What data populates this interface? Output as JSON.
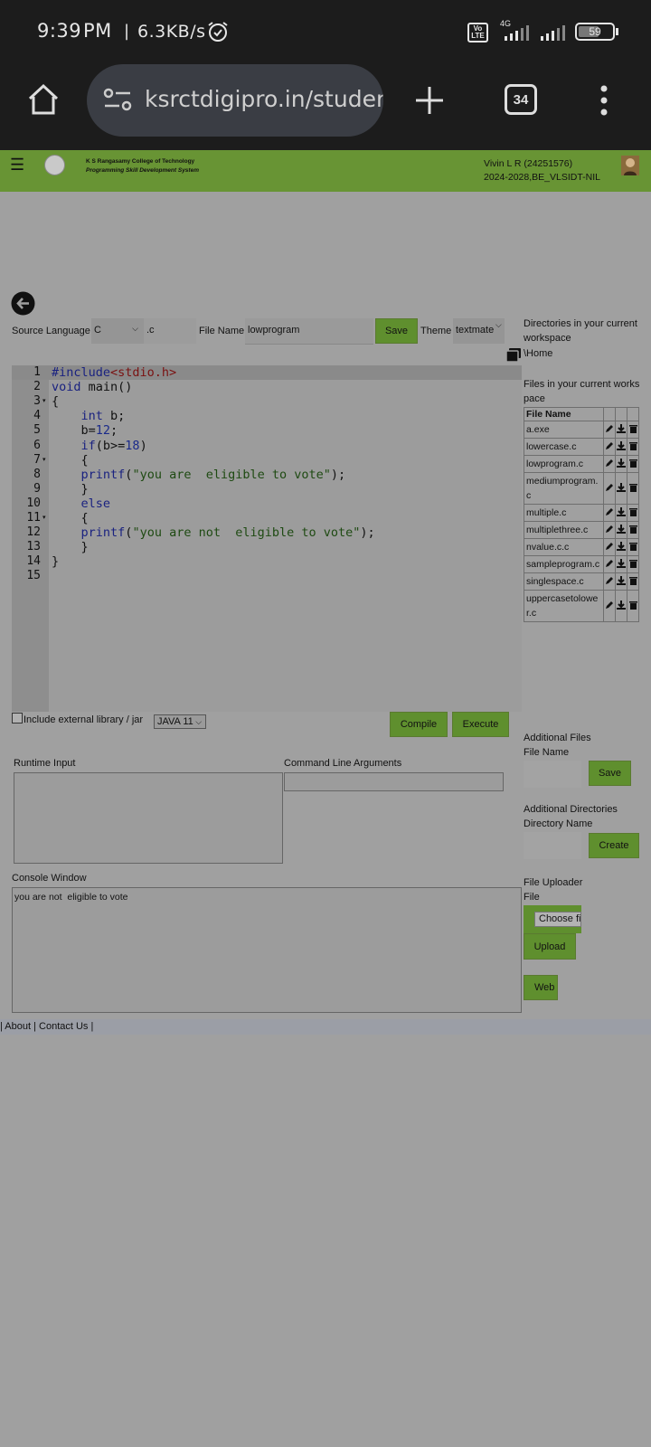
{
  "status_bar": {
    "time": "9:39",
    "ampm": "PM",
    "speed": "6.3KB/s",
    "volte": "Vo\nLTE",
    "network": "4G",
    "battery": "59"
  },
  "browser": {
    "url": "ksrctdigipro.in/student",
    "tab_count": "34"
  },
  "header": {
    "college_name": "K S Rangasamy College of Technology",
    "system_name": "Programming Skill Development System",
    "user_line1": "Vivin L R (24251576)",
    "user_line2": "2024-2028,BE_VLSIDT-NIL"
  },
  "toolbar": {
    "source_language_label": "Source Language",
    "language_value": "C",
    "extension_value": ".c",
    "file_name_label": "File Name",
    "file_name_value": "lowprogram",
    "save_label": "Save",
    "theme_label": "Theme",
    "theme_value": "textmate"
  },
  "editor": {
    "line_numbers": [
      "1",
      "2",
      "3",
      "4",
      "5",
      "6",
      "7",
      "8",
      "9",
      "10",
      "11",
      "12",
      "13",
      "14",
      "15"
    ],
    "lines": [
      "#include<stdio.h>",
      "void main()",
      "{",
      "    int b;",
      "    b=12;",
      "    if(b>=18)",
      "    {",
      "    printf(\"you are  eligible to vote\");",
      "    }",
      "    else",
      "    {",
      "    printf(\"you are not  eligible to vote\");",
      "    }",
      "}",
      ""
    ]
  },
  "options": {
    "include_library_label": "Include external library / jar",
    "java_version": "JAVA 11",
    "compile_label": "Compile",
    "execute_label": "Execute"
  },
  "io": {
    "runtime_input_label": "Runtime Input",
    "runtime_input_value": "",
    "cmd_args_label": "Command Line Arguments",
    "cmd_args_value": "",
    "console_label": "Console Window",
    "console_output": "you are not  eligible to vote"
  },
  "sidebar": {
    "dirs_heading": "Directories in your current workspace",
    "home_dir": "\\Home",
    "files_heading": "Files in your current workspace",
    "file_name_header": "File Name",
    "files": [
      "a.exe",
      "lowercase.c",
      "lowprogram.c",
      "mediumprogram.c",
      "multiple.c",
      "multiplethree.c",
      "nvalue.c.c",
      "sampleprogram.c",
      "singlespace.c",
      "uppercasetolower.c"
    ],
    "additional_files_heading": "Additional Files",
    "additional_file_name_label": "File Name",
    "additional_save_label": "Save",
    "additional_dirs_heading": "Additional Directories",
    "directory_name_label": "Directory Name",
    "create_label": "Create",
    "uploader_heading": "File Uploader",
    "file_label": "File",
    "choose_file_label": "Choose fi",
    "upload_label": "Upload",
    "web_label": "Web I"
  },
  "footer": {
    "text": "| About | Contact Us |"
  }
}
